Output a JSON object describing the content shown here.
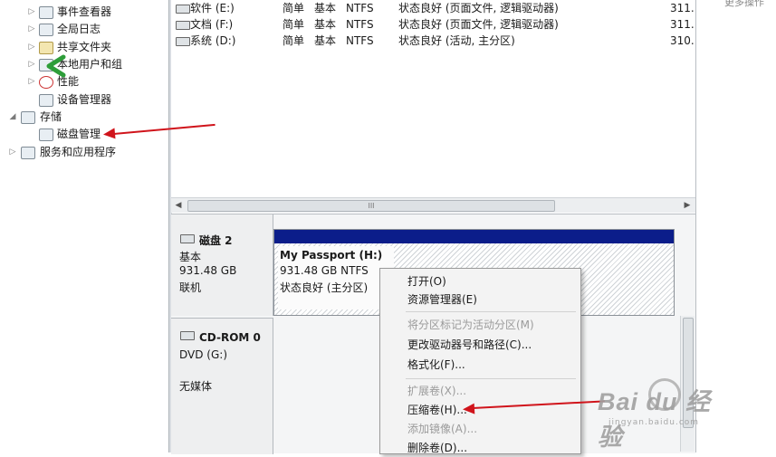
{
  "tree": {
    "items": [
      {
        "label": "事件查看器",
        "expander": "▷"
      },
      {
        "label": "全局日志",
        "expander": "▷"
      },
      {
        "label": "共享文件夹",
        "expander": "▷"
      },
      {
        "label": "本地用户和组",
        "expander": "▷"
      },
      {
        "label": "性能",
        "expander": "▷"
      },
      {
        "label": "设备管理器",
        "expander": ""
      },
      {
        "label": "存储",
        "expander": "◢"
      },
      {
        "label": "磁盘管理",
        "expander": ""
      },
      {
        "label": "服务和应用程序",
        "expander": "▷"
      }
    ]
  },
  "volumes": {
    "rows": [
      {
        "name": "软件 (E:)",
        "layout": "简单",
        "type": "基本",
        "fs": "NTFS",
        "status": "状态良好 (页面文件, 逻辑驱动器)",
        "capacity": "311."
      },
      {
        "name": "文档 (F:)",
        "layout": "简单",
        "type": "基本",
        "fs": "NTFS",
        "status": "状态良好 (页面文件, 逻辑驱动器)",
        "capacity": "311."
      },
      {
        "name": "系统 (D:)",
        "layout": "简单",
        "type": "基本",
        "fs": "NTFS",
        "status": "状态良好 (活动, 主分区)",
        "capacity": "310."
      }
    ]
  },
  "scrollbar": {
    "left_arrow": "◀",
    "right_arrow": "▶",
    "grip": "III"
  },
  "disks": {
    "disk2": {
      "name": "磁盘 2",
      "type": "基本",
      "size": "931.48 GB",
      "state": "联机"
    },
    "cdrom0": {
      "name": "CD-ROM 0",
      "drive": "DVD (G:)",
      "media": "无媒体"
    }
  },
  "partition": {
    "name": "My Passport (H:)",
    "size_fs": "931.48 GB NTFS",
    "status": "状态良好 (主分区)"
  },
  "context_menu": {
    "items": [
      {
        "label": "打开(O)",
        "enabled": true
      },
      {
        "label": "资源管理器(E)",
        "enabled": true
      },
      {
        "label": "将分区标记为活动分区(M)",
        "enabled": false
      },
      {
        "label": "更改驱动器号和路径(C)...",
        "enabled": true
      },
      {
        "label": "格式化(F)...",
        "enabled": true
      },
      {
        "label": "扩展卷(X)...",
        "enabled": false
      },
      {
        "label": "压缩卷(H)...",
        "enabled": true
      },
      {
        "label": "添加镜像(A)...",
        "enabled": false
      },
      {
        "label": "删除卷(D)...",
        "enabled": true
      }
    ]
  },
  "top_right": {
    "text": "更多操作"
  },
  "watermark": {
    "main": "Bai du 经验",
    "sub": "jingyan.baidu.com"
  },
  "colors": {
    "arrow": "#d0141b",
    "partition_bar": "#0b1d8a",
    "cursor": "#2e9e3a"
  }
}
